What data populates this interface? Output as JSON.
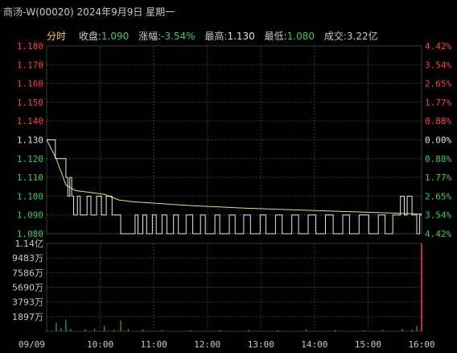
{
  "header": {
    "title": "商汤-W(00020) 2024年9月9日 星期一",
    "tab": "分时",
    "close_label": "收盘:",
    "close_value": "1.090",
    "change_label": "涨幅:",
    "change_value": "-3.54%",
    "high_label": "最高:",
    "high_value": "1.130",
    "low_label": "最低:",
    "low_value": "1.080",
    "turnover_label": "成交:",
    "turnover_value": "3.22亿"
  },
  "colors": {
    "background": "#000000",
    "grid": "#3a3a3a",
    "price_line": "#e8e8e8",
    "avg_line": "#e6e65a",
    "up": "#ff4040",
    "down": "#30d060",
    "flat": "#e0e0e0",
    "volume_bar": "#30d060",
    "volume_last": "#ff4040",
    "label": "#c8c8c8"
  },
  "chart_data": {
    "type": "line",
    "title": "商汤-W(00020) 2024年9月9日 星期一",
    "prev_close": 1.13,
    "price_axis": {
      "ticks": [
        "1.180",
        "1.170",
        "1.160",
        "1.150",
        "1.140",
        "1.130",
        "1.120",
        "1.110",
        "1.100",
        "1.090",
        "1.080"
      ],
      "range": [
        1.08,
        1.18
      ]
    },
    "pct_axis": {
      "ticks": [
        "4.42%",
        "3.54%",
        "2.65%",
        "1.77%",
        "0.88%",
        "0.00%",
        "0.88%",
        "1.77%",
        "2.65%",
        "3.54%",
        "4.42%"
      ]
    },
    "volume_axis": {
      "ticks": [
        "1.14亿",
        "9483万",
        "7586万",
        "5690万",
        "3793万",
        "1897万"
      ],
      "max_wan": 11400
    },
    "time_axis": {
      "ticks": [
        "09/09",
        "10:00",
        "11:00",
        "12:00",
        "13:00",
        "14:00",
        "15:00",
        "16:00"
      ]
    },
    "price_series": [
      {
        "t": "09:30",
        "v": 1.13
      },
      {
        "t": "09:38",
        "v": 1.13
      },
      {
        "t": "09:39",
        "v": 1.12
      },
      {
        "t": "09:45",
        "v": 1.12
      },
      {
        "t": "09:50",
        "v": 1.11
      },
      {
        "t": "09:52",
        "v": 1.1
      },
      {
        "t": "09:54",
        "v": 1.11
      },
      {
        "t": "09:56",
        "v": 1.1
      },
      {
        "t": "09:58",
        "v": 1.09
      },
      {
        "t": "10:02",
        "v": 1.1
      },
      {
        "t": "10:05",
        "v": 1.09
      },
      {
        "t": "10:12",
        "v": 1.1
      },
      {
        "t": "10:16",
        "v": 1.09
      },
      {
        "t": "10:22",
        "v": 1.1
      },
      {
        "t": "10:27",
        "v": 1.09
      },
      {
        "t": "10:32",
        "v": 1.1
      },
      {
        "t": "10:38",
        "v": 1.09
      },
      {
        "t": "10:46",
        "v": 1.09
      },
      {
        "t": "10:47",
        "v": 1.08
      },
      {
        "t": "11:00",
        "v": 1.08
      },
      {
        "t": "11:02",
        "v": 1.09
      },
      {
        "t": "11:05",
        "v": 1.08
      },
      {
        "t": "11:10",
        "v": 1.09
      },
      {
        "t": "11:14",
        "v": 1.08
      },
      {
        "t": "11:20",
        "v": 1.09
      },
      {
        "t": "11:24",
        "v": 1.08
      },
      {
        "t": "11:30",
        "v": 1.09
      },
      {
        "t": "11:35",
        "v": 1.08
      },
      {
        "t": "11:42",
        "v": 1.09
      },
      {
        "t": "11:47",
        "v": 1.08
      },
      {
        "t": "11:55",
        "v": 1.09
      },
      {
        "t": "12:02",
        "v": 1.08
      },
      {
        "t": "12:10",
        "v": 1.09
      },
      {
        "t": "12:15",
        "v": 1.08
      },
      {
        "t": "12:25",
        "v": 1.09
      },
      {
        "t": "12:30",
        "v": 1.08
      },
      {
        "t": "12:40",
        "v": 1.09
      },
      {
        "t": "12:46",
        "v": 1.08
      },
      {
        "t": "12:55",
        "v": 1.09
      },
      {
        "t": "13:02",
        "v": 1.08
      },
      {
        "t": "13:12",
        "v": 1.09
      },
      {
        "t": "13:18",
        "v": 1.08
      },
      {
        "t": "13:28",
        "v": 1.09
      },
      {
        "t": "13:35",
        "v": 1.08
      },
      {
        "t": "13:45",
        "v": 1.09
      },
      {
        "t": "13:52",
        "v": 1.08
      },
      {
        "t": "14:02",
        "v": 1.09
      },
      {
        "t": "14:10",
        "v": 1.08
      },
      {
        "t": "14:20",
        "v": 1.09
      },
      {
        "t": "14:28",
        "v": 1.08
      },
      {
        "t": "14:38",
        "v": 1.09
      },
      {
        "t": "14:45",
        "v": 1.08
      },
      {
        "t": "14:55",
        "v": 1.09
      },
      {
        "t": "15:05",
        "v": 1.08
      },
      {
        "t": "15:15",
        "v": 1.09
      },
      {
        "t": "15:22",
        "v": 1.08
      },
      {
        "t": "15:30",
        "v": 1.09
      },
      {
        "t": "15:38",
        "v": 1.1
      },
      {
        "t": "15:42",
        "v": 1.09
      },
      {
        "t": "15:45",
        "v": 1.1
      },
      {
        "t": "15:50",
        "v": 1.09
      },
      {
        "t": "15:55",
        "v": 1.08
      },
      {
        "t": "15:58",
        "v": 1.09
      },
      {
        "t": "16:00",
        "v": 1.09
      }
    ],
    "avg_series": [
      {
        "t": "09:30",
        "v": 1.13
      },
      {
        "t": "09:40",
        "v": 1.12
      },
      {
        "t": "09:50",
        "v": 1.106
      },
      {
        "t": "10:00",
        "v": 1.103
      },
      {
        "t": "10:30",
        "v": 1.101
      },
      {
        "t": "10:45",
        "v": 1.098
      },
      {
        "t": "11:00",
        "v": 1.097
      },
      {
        "t": "12:00",
        "v": 1.095
      },
      {
        "t": "13:00",
        "v": 1.0935
      },
      {
        "t": "14:00",
        "v": 1.0925
      },
      {
        "t": "15:00",
        "v": 1.0915
      },
      {
        "t": "16:00",
        "v": 1.0905
      }
    ],
    "volume_series": [
      {
        "t": "09:30",
        "v": 120
      },
      {
        "t": "09:40",
        "v": 1100
      },
      {
        "t": "09:45",
        "v": 400
      },
      {
        "t": "09:50",
        "v": 1500
      },
      {
        "t": "09:55",
        "v": 300
      },
      {
        "t": "10:10",
        "v": 250
      },
      {
        "t": "10:20",
        "v": 350
      },
      {
        "t": "10:30",
        "v": 700
      },
      {
        "t": "10:40",
        "v": 200
      },
      {
        "t": "10:47",
        "v": 1400
      },
      {
        "t": "10:55",
        "v": 300
      },
      {
        "t": "11:10",
        "v": 200
      },
      {
        "t": "11:30",
        "v": 150
      },
      {
        "t": "12:00",
        "v": 120
      },
      {
        "t": "12:30",
        "v": 150
      },
      {
        "t": "13:00",
        "v": 180
      },
      {
        "t": "13:30",
        "v": 120
      },
      {
        "t": "14:00",
        "v": 200
      },
      {
        "t": "14:30",
        "v": 150
      },
      {
        "t": "15:00",
        "v": 120
      },
      {
        "t": "15:20",
        "v": 150
      },
      {
        "t": "15:40",
        "v": 300
      },
      {
        "t": "15:50",
        "v": 200
      },
      {
        "t": "15:55",
        "v": 700
      },
      {
        "t": "16:00",
        "v": 11400
      }
    ]
  }
}
